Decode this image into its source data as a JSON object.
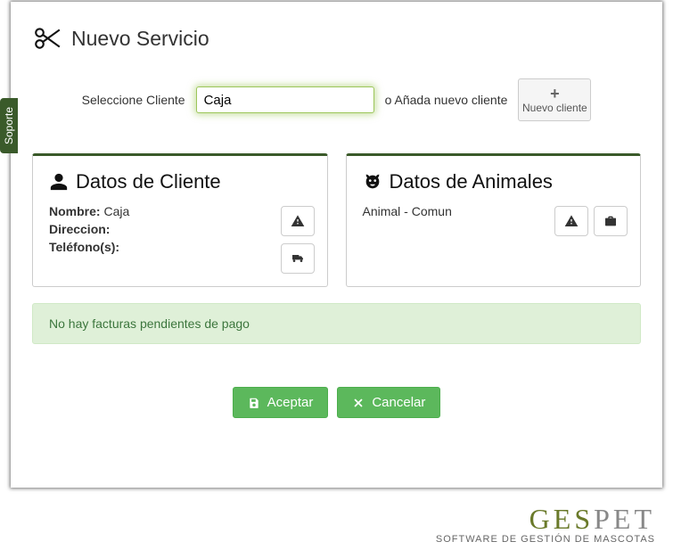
{
  "header": {
    "title": "Nuevo Servicio"
  },
  "clientSelect": {
    "label": "Seleccione Cliente",
    "value": "Caja",
    "orLabel": "o Añada nuevo cliente",
    "newBtn": "Nuevo cliente"
  },
  "clientPanel": {
    "title": "Datos de Cliente",
    "nameLabel": "Nombre:",
    "nameValue": "Caja",
    "addressLabel": "Direccion:",
    "addressValue": "",
    "phoneLabel": "Teléfono(s):",
    "phoneValue": ""
  },
  "animalPanel": {
    "title": "Datos de Animales",
    "animalLine": "Animal - Comun"
  },
  "invoiceAlert": "No hay facturas pendientes de pago",
  "actions": {
    "accept": "Aceptar",
    "cancel": "Cancelar"
  },
  "supportTab": "Soporte",
  "footer": {
    "brand1": "GES",
    "brand2": "PET",
    "tagline": "SOFTWARE DE GESTIÓN DE MASCOTAS"
  }
}
